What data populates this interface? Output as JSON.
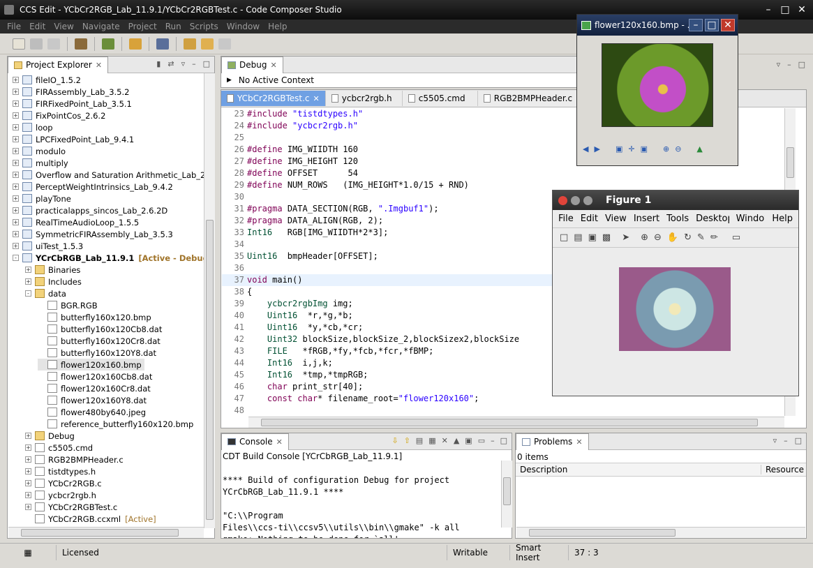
{
  "window": {
    "title": "CCS Edit - YCbCr2RGB_Lab_11.9.1/YCbCr2RGBTest.c - Code Composer Studio"
  },
  "menu": [
    "File",
    "Edit",
    "View",
    "Navigate",
    "Project",
    "Run",
    "Scripts",
    "Window",
    "Help"
  ],
  "project_explorer": {
    "title": "Project Explorer",
    "items": [
      {
        "label": "fileIO_1.5.2",
        "extra": "",
        "level": 0,
        "type": "prj",
        "exp": "+"
      },
      {
        "label": "FIRAssembly_Lab_3.5.2",
        "extra": "",
        "level": 0,
        "type": "prj",
        "exp": "+"
      },
      {
        "label": "FIRFixedPoint_Lab_3.5.1",
        "extra": "",
        "level": 0,
        "type": "prj",
        "exp": "+"
      },
      {
        "label": "FixPointCos_2.6.2",
        "extra": "",
        "level": 0,
        "type": "prj",
        "exp": "+"
      },
      {
        "label": "loop",
        "extra": "",
        "level": 0,
        "type": "prj",
        "exp": "+"
      },
      {
        "label": "LPCFixedPoint_Lab_9.4.1",
        "extra": "",
        "level": 0,
        "type": "prj",
        "exp": "+"
      },
      {
        "label": "modulo",
        "extra": "",
        "level": 0,
        "type": "prj",
        "exp": "+"
      },
      {
        "label": "multiply",
        "extra": "",
        "level": 0,
        "type": "prj",
        "exp": "+"
      },
      {
        "label": "Overflow and Saturation Arithmetic_Lab_2.6.1",
        "extra": "",
        "level": 0,
        "type": "prj",
        "exp": "+"
      },
      {
        "label": "PerceptWeightIntrinsics_Lab_9.4.2",
        "extra": "",
        "level": 0,
        "type": "prj",
        "exp": "+"
      },
      {
        "label": "playTone",
        "extra": "",
        "level": 0,
        "type": "prj",
        "exp": "+"
      },
      {
        "label": "practicalapps_sincos_Lab_2.6.2D",
        "extra": "",
        "level": 0,
        "type": "prj",
        "exp": "+"
      },
      {
        "label": "RealTimeAudioLoop_1.5.5",
        "extra": "",
        "level": 0,
        "type": "prj",
        "exp": "+"
      },
      {
        "label": "SymmetricFIRAssembly_Lab_3.5.3",
        "extra": "",
        "level": 0,
        "type": "prj",
        "exp": "+"
      },
      {
        "label": "uiTest_1.5.3",
        "extra": "",
        "level": 0,
        "type": "prj",
        "exp": "+"
      },
      {
        "label": "YCrCbRGB_Lab_11.9.1",
        "extra": "[Active - Debug]",
        "level": 0,
        "type": "prj",
        "exp": "-",
        "bold": true
      },
      {
        "label": "Binaries",
        "extra": "",
        "level": 1,
        "type": "folder",
        "exp": "+"
      },
      {
        "label": "Includes",
        "extra": "",
        "level": 1,
        "type": "folder",
        "exp": "+"
      },
      {
        "label": "data",
        "extra": "",
        "level": 1,
        "type": "folder",
        "exp": "-"
      },
      {
        "label": "BGR.RGB",
        "extra": "",
        "level": 2,
        "type": "file",
        "exp": ""
      },
      {
        "label": "butterfly160x120.bmp",
        "extra": "",
        "level": 2,
        "type": "file",
        "exp": ""
      },
      {
        "label": "butterfly160x120Cb8.dat",
        "extra": "",
        "level": 2,
        "type": "file",
        "exp": ""
      },
      {
        "label": "butterfly160x120Cr8.dat",
        "extra": "",
        "level": 2,
        "type": "file",
        "exp": ""
      },
      {
        "label": "butterfly160x120Y8.dat",
        "extra": "",
        "level": 2,
        "type": "file",
        "exp": ""
      },
      {
        "label": "flower120x160.bmp",
        "extra": "",
        "level": 2,
        "type": "file",
        "exp": "",
        "sel": true
      },
      {
        "label": "flower120x160Cb8.dat",
        "extra": "",
        "level": 2,
        "type": "file",
        "exp": ""
      },
      {
        "label": "flower120x160Cr8.dat",
        "extra": "",
        "level": 2,
        "type": "file",
        "exp": ""
      },
      {
        "label": "flower120x160Y8.dat",
        "extra": "",
        "level": 2,
        "type": "file",
        "exp": ""
      },
      {
        "label": "flower480by640.jpeg",
        "extra": "",
        "level": 2,
        "type": "file",
        "exp": ""
      },
      {
        "label": "reference_butterfly160x120.bmp",
        "extra": "",
        "level": 2,
        "type": "file",
        "exp": ""
      },
      {
        "label": "Debug",
        "extra": "",
        "level": 1,
        "type": "folder",
        "exp": "+"
      },
      {
        "label": "c5505.cmd",
        "extra": "",
        "level": 1,
        "type": "file",
        "exp": "+"
      },
      {
        "label": "RGB2BMPHeader.c",
        "extra": "",
        "level": 1,
        "type": "file",
        "exp": "+"
      },
      {
        "label": "tistdtypes.h",
        "extra": "",
        "level": 1,
        "type": "file",
        "exp": "+"
      },
      {
        "label": "YCbCr2RGB.c",
        "extra": "",
        "level": 1,
        "type": "file",
        "exp": "+"
      },
      {
        "label": "ycbcr2rgb.h",
        "extra": "",
        "level": 1,
        "type": "file",
        "exp": "+"
      },
      {
        "label": "YCbCr2RGBTest.c",
        "extra": "",
        "level": 1,
        "type": "file",
        "exp": "+"
      },
      {
        "label": "YCbCr2RGB.ccxml",
        "extra": "[Active]",
        "level": 1,
        "type": "file",
        "exp": ""
      }
    ]
  },
  "debug": {
    "title": "Debug",
    "context": "No Active Context"
  },
  "editor": {
    "tabs": [
      "YCbCr2RGBTest.c",
      "ycbcr2rgb.h",
      "c5505.cmd",
      "RGB2BMPHeader.c"
    ],
    "lines": [
      {
        "n": "23",
        "segs": [
          [
            "pp",
            "#include "
          ],
          [
            "str",
            "\"tistdtypes.h\""
          ]
        ]
      },
      {
        "n": "24",
        "segs": [
          [
            "pp",
            "#include "
          ],
          [
            "str",
            "\"ycbcr2rgb.h\""
          ]
        ]
      },
      {
        "n": "25",
        "segs": []
      },
      {
        "n": "26",
        "segs": [
          [
            "pp",
            "#define"
          ],
          [
            "",
            "IMG_WIIDTH 160"
          ]
        ]
      },
      {
        "n": "27",
        "segs": [
          [
            "pp",
            "#define"
          ],
          [
            "",
            "IMG_HEIGHT 120"
          ]
        ]
      },
      {
        "n": "28",
        "segs": [
          [
            "pp",
            "#define"
          ],
          [
            "",
            "OFFSET      54"
          ]
        ]
      },
      {
        "n": "29",
        "segs": [
          [
            "pp",
            "#define"
          ],
          [
            "",
            "NUM_ROWS   (IMG_HEIGHT*1.0/15 + RND)"
          ]
        ]
      },
      {
        "n": "30",
        "segs": []
      },
      {
        "n": "31",
        "segs": [
          [
            "pp",
            "#pragma"
          ],
          [
            "",
            "DATA_SECTION(RGB, "
          ],
          [
            "str",
            "\".Imgbuf1\""
          ],
          [
            "",
            ");"
          ]
        ]
      },
      {
        "n": "32",
        "segs": [
          [
            "pp",
            "#pragma"
          ],
          [
            "",
            "DATA_ALIGN(RGB, 2);"
          ]
        ]
      },
      {
        "n": "33",
        "segs": [
          [
            "ty",
            "Int16"
          ],
          [
            "",
            "   RGB[IMG_WIIDTH*2*3];"
          ]
        ]
      },
      {
        "n": "34",
        "segs": []
      },
      {
        "n": "35",
        "segs": [
          [
            "ty",
            "Uint16"
          ],
          [
            "",
            "  bmpHeader[OFFSET];"
          ]
        ]
      },
      {
        "n": "36",
        "segs": []
      },
      {
        "n": "37",
        "segs": [
          [
            "kw",
            "void"
          ],
          [
            "",
            " main()"
          ]
        ],
        "cur": true
      },
      {
        "n": "38",
        "segs": [
          [
            "",
            "{"
          ]
        ]
      },
      {
        "n": "39",
        "segs": [
          [
            "ty",
            "    ycbcr2rgbImg"
          ],
          [
            "",
            " img;"
          ]
        ]
      },
      {
        "n": "40",
        "segs": [
          [
            "ty",
            "    Uint16"
          ],
          [
            "",
            "  *r,*g,*b;"
          ]
        ]
      },
      {
        "n": "41",
        "segs": [
          [
            "ty",
            "    Uint16"
          ],
          [
            "",
            "  *y,*cb,*cr;"
          ]
        ]
      },
      {
        "n": "42",
        "segs": [
          [
            "ty",
            "    Uint32"
          ],
          [
            "",
            " blockSize,blockSize_2,blockSizex2,blockSize"
          ]
        ]
      },
      {
        "n": "43",
        "segs": [
          [
            "ty",
            "    FILE"
          ],
          [
            "",
            "   *fRGB,*fy,*fcb,*fcr,*fBMP;"
          ]
        ]
      },
      {
        "n": "44",
        "segs": [
          [
            "ty",
            "    Int16"
          ],
          [
            "",
            "  i,j,k;"
          ]
        ]
      },
      {
        "n": "45",
        "segs": [
          [
            "ty",
            "    Int16"
          ],
          [
            "",
            "  *tmp,*tmpRGB;"
          ]
        ]
      },
      {
        "n": "46",
        "segs": [
          [
            "kw",
            "    char"
          ],
          [
            "",
            " print_str[40];"
          ]
        ]
      },
      {
        "n": "47",
        "segs": [
          [
            "kw",
            "    const char"
          ],
          [
            "",
            "* filename_root="
          ],
          [
            "str",
            "\"flower120x160\""
          ],
          [
            "",
            ";"
          ]
        ]
      },
      {
        "n": "48",
        "segs": []
      }
    ]
  },
  "console": {
    "title": "Console",
    "header": "CDT Build Console [YCrCbRGB_Lab_11.9.1]",
    "lines": [
      "",
      "**** Build of configuration Debug for project",
      "YCrCbRGB_Lab_11.9.1 ****",
      "",
      "\"C:\\\\Program",
      "Files\\\\ccs-ti\\\\ccsv5\\\\utils\\\\bin\\\\gmake\" -k all",
      "gmake: Nothing to be done for `all'."
    ]
  },
  "problems": {
    "title": "Problems",
    "count": "0 items",
    "col_description": "Description",
    "col_resource": "Resource"
  },
  "image_window": {
    "title": "flower120x160.bmp - ..."
  },
  "figure": {
    "title": "Figure 1",
    "menu": [
      "File",
      "Edit",
      "View",
      "Insert",
      "Tools",
      "Desktop",
      "Window",
      "Help"
    ]
  },
  "statusbar": {
    "license": "Licensed",
    "mode": "Writable",
    "insert": "Smart Insert",
    "pos": "37 : 3"
  },
  "colors": {
    "titlebar": "#111111",
    "selection": "#6fa0e3",
    "keyword": "#7f0055",
    "string": "#2a00ff"
  }
}
